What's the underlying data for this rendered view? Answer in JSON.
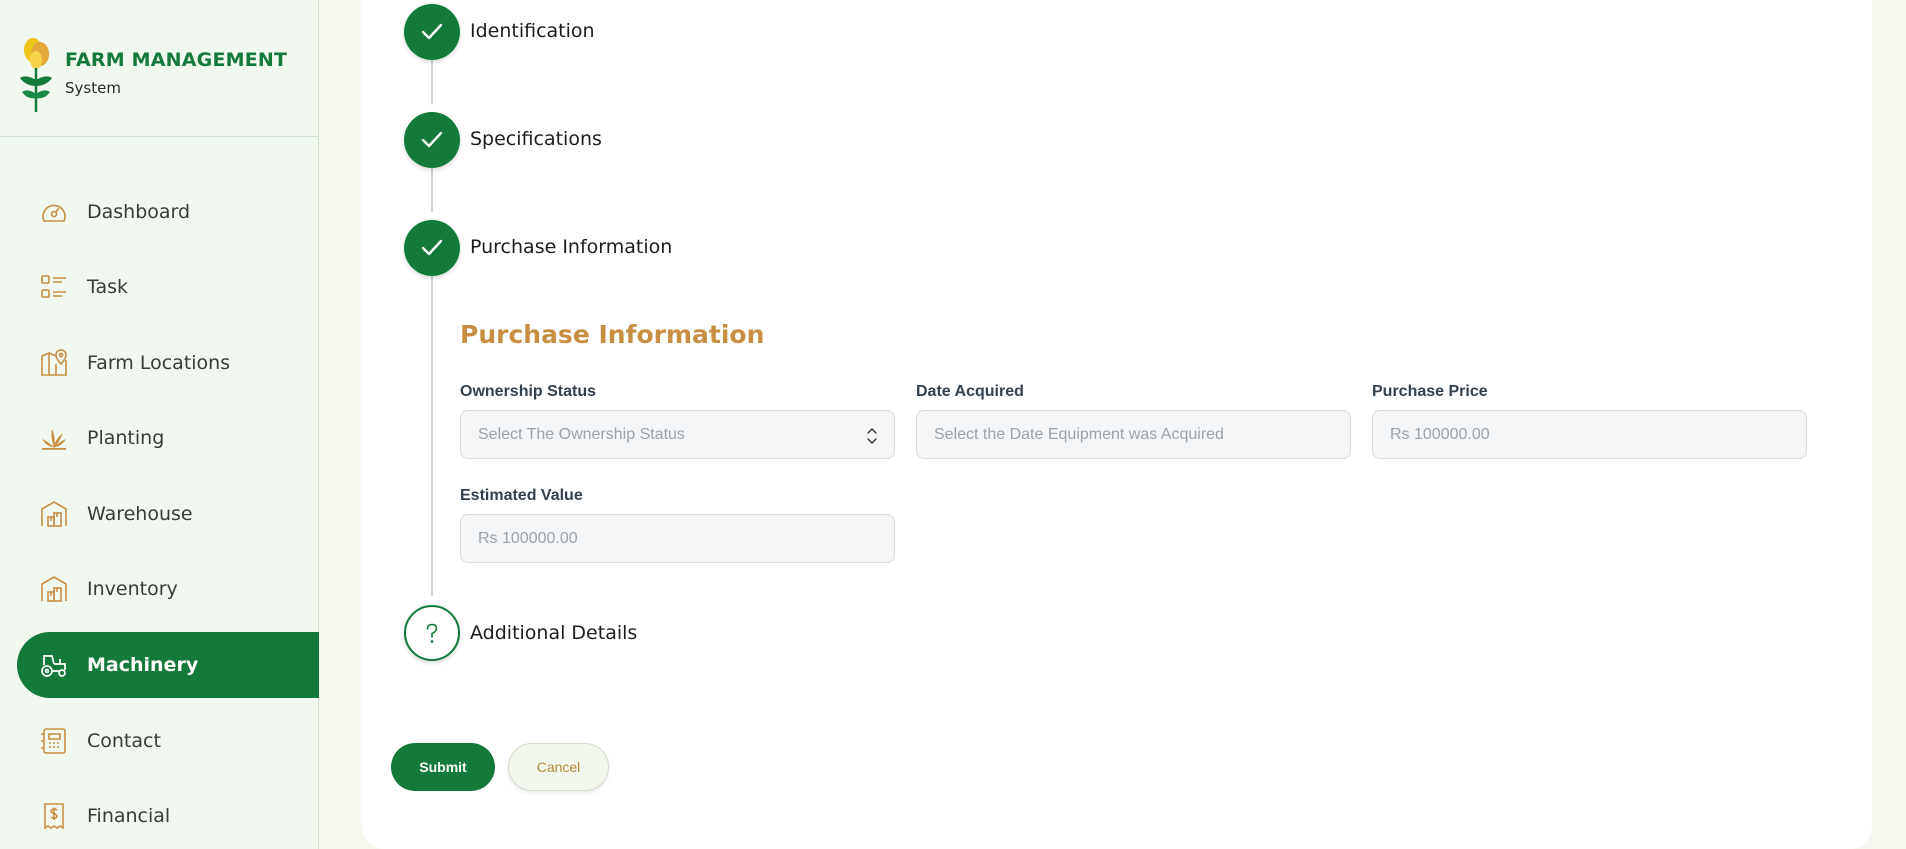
{
  "brand": {
    "title": "FARM MANAGEMENT",
    "subtitle": "System"
  },
  "sidebar": {
    "items": [
      {
        "label": "Dashboard",
        "icon": "dashboard-gauge-icon",
        "active": false
      },
      {
        "label": "Task",
        "icon": "task-list-icon",
        "active": false
      },
      {
        "label": "Farm Locations",
        "icon": "map-pin-icon",
        "active": false
      },
      {
        "label": "Planting",
        "icon": "plant-icon",
        "active": false
      },
      {
        "label": "Warehouse",
        "icon": "warehouse-icon",
        "active": false
      },
      {
        "label": "Inventory",
        "icon": "inventory-icon",
        "active": false
      },
      {
        "label": "Machinery",
        "icon": "tractor-icon",
        "active": true
      },
      {
        "label": "Contact",
        "icon": "contact-book-icon",
        "active": false
      },
      {
        "label": "Financial",
        "icon": "receipt-dollar-icon",
        "active": false
      }
    ]
  },
  "stepper": {
    "steps": [
      {
        "label": "Identification",
        "status": "complete"
      },
      {
        "label": "Specifications",
        "status": "complete"
      },
      {
        "label": "Purchase Information",
        "status": "complete"
      },
      {
        "label": "Additional Details",
        "status": "pending"
      }
    ]
  },
  "form": {
    "section_title": "Purchase Information",
    "ownership_status": {
      "label": "Ownership Status",
      "placeholder": "Select The Ownership Status"
    },
    "date_acquired": {
      "label": "Date Acquired",
      "placeholder": "Select the Date Equipment was Acquired"
    },
    "purchase_price": {
      "label": "Purchase Price",
      "placeholder": "Rs 100000.00"
    },
    "estimated_value": {
      "label": "Estimated Value",
      "placeholder": "Rs 100000.00"
    }
  },
  "actions": {
    "submit_label": "Submit",
    "cancel_label": "Cancel"
  },
  "colors": {
    "primary_green": "#137a3c",
    "accent_gold": "#c88f44",
    "sidebar_bg": "#f1f8ef"
  }
}
